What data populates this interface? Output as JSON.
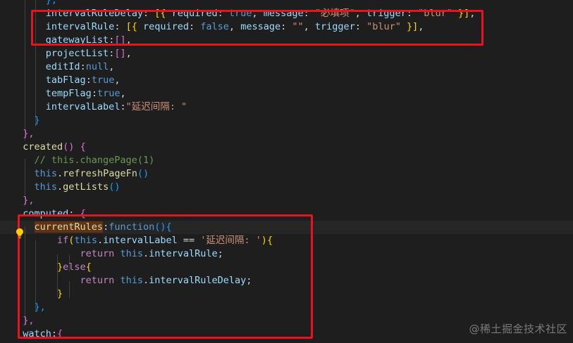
{
  "colors": {
    "background": "#1e1e1e",
    "plain": "#d4d4d4",
    "property": "#9cdcfe",
    "string": "#ce9178",
    "keyword": "#569cd6",
    "function": "#dcdcaa",
    "comment": "#6a9955",
    "control": "#c586c0",
    "bracket_gold": "#ffd700",
    "bracket_blue": "#179fff",
    "bracket_pink": "#da70d6",
    "highlight_box": "#e5141e"
  },
  "code": {
    "lines": [
      [
        {
          "t": "      ",
          "c": "plain"
        },
        {
          "t": "},",
          "c": "bracket_blue"
        }
      ],
      [
        {
          "t": "      ",
          "c": "plain"
        },
        {
          "t": "intervalRuleDelay",
          "c": "property"
        },
        {
          "t": ": ",
          "c": "plain"
        },
        {
          "t": "[{",
          "c": "bracket_gold"
        },
        {
          "t": " required",
          "c": "property"
        },
        {
          "t": ": ",
          "c": "plain"
        },
        {
          "t": "true",
          "c": "keyword"
        },
        {
          "t": ", ",
          "c": "plain"
        },
        {
          "t": "message",
          "c": "property"
        },
        {
          "t": ": ",
          "c": "plain"
        },
        {
          "t": "\"必填项\"",
          "c": "string"
        },
        {
          "t": ", ",
          "c": "plain"
        },
        {
          "t": "trigger",
          "c": "property"
        },
        {
          "t": ": ",
          "c": "plain"
        },
        {
          "t": "\"blur\"",
          "c": "string"
        },
        {
          "t": " }]",
          "c": "bracket_gold"
        },
        {
          "t": ",",
          "c": "plain"
        }
      ],
      [
        {
          "t": "      ",
          "c": "plain"
        },
        {
          "t": "intervalRule",
          "c": "property"
        },
        {
          "t": ": ",
          "c": "plain"
        },
        {
          "t": "[{",
          "c": "bracket_gold"
        },
        {
          "t": " required",
          "c": "property"
        },
        {
          "t": ": ",
          "c": "plain"
        },
        {
          "t": "false",
          "c": "keyword"
        },
        {
          "t": ", ",
          "c": "plain"
        },
        {
          "t": "message",
          "c": "property"
        },
        {
          "t": ": ",
          "c": "plain"
        },
        {
          "t": "\"\"",
          "c": "string"
        },
        {
          "t": ", ",
          "c": "plain"
        },
        {
          "t": "trigger",
          "c": "property"
        },
        {
          "t": ": ",
          "c": "plain"
        },
        {
          "t": "\"blur\"",
          "c": "string"
        },
        {
          "t": " }]",
          "c": "bracket_gold"
        },
        {
          "t": ",",
          "c": "plain"
        }
      ],
      [
        {
          "t": "      ",
          "c": "plain"
        },
        {
          "t": "gatewayList",
          "c": "property"
        },
        {
          "t": ":",
          "c": "plain"
        },
        {
          "t": "[]",
          "c": "bracket_pink"
        },
        {
          "t": ",",
          "c": "plain"
        }
      ],
      [
        {
          "t": "      ",
          "c": "plain"
        },
        {
          "t": "projectList",
          "c": "property"
        },
        {
          "t": ":",
          "c": "plain"
        },
        {
          "t": "[]",
          "c": "bracket_pink"
        },
        {
          "t": ",",
          "c": "plain"
        }
      ],
      [
        {
          "t": "      ",
          "c": "plain"
        },
        {
          "t": "editId",
          "c": "property"
        },
        {
          "t": ":",
          "c": "plain"
        },
        {
          "t": "null",
          "c": "keyword"
        },
        {
          "t": ",",
          "c": "plain"
        }
      ],
      [
        {
          "t": "      ",
          "c": "plain"
        },
        {
          "t": "tabFlag",
          "c": "property"
        },
        {
          "t": ":",
          "c": "plain"
        },
        {
          "t": "true",
          "c": "keyword"
        },
        {
          "t": ",",
          "c": "plain"
        }
      ],
      [
        {
          "t": "      ",
          "c": "plain"
        },
        {
          "t": "tempFlag",
          "c": "property"
        },
        {
          "t": ":",
          "c": "plain"
        },
        {
          "t": "true",
          "c": "keyword"
        },
        {
          "t": ",",
          "c": "plain"
        }
      ],
      [
        {
          "t": "      ",
          "c": "plain"
        },
        {
          "t": "intervalLabel",
          "c": "property"
        },
        {
          "t": ":",
          "c": "plain"
        },
        {
          "t": "\"延迟间隔: \"",
          "c": "string"
        }
      ],
      [
        {
          "t": "    ",
          "c": "plain"
        },
        {
          "t": "}",
          "c": "bracket_blue"
        }
      ],
      [
        {
          "t": "  ",
          "c": "plain"
        },
        {
          "t": "},",
          "c": "bracket_pink"
        }
      ],
      [
        {
          "t": "  ",
          "c": "plain"
        },
        {
          "t": "created",
          "c": "function"
        },
        {
          "t": "()",
          "c": "bracket_pink"
        },
        {
          "t": " ",
          "c": "plain"
        },
        {
          "t": "{",
          "c": "bracket_pink"
        }
      ],
      [
        {
          "t": "    ",
          "c": "plain"
        },
        {
          "t": "// this.changePage(1)",
          "c": "comment"
        }
      ],
      [
        {
          "t": "    ",
          "c": "plain"
        },
        {
          "t": "this",
          "c": "keyword"
        },
        {
          "t": ".",
          "c": "plain"
        },
        {
          "t": "refreshPageFn",
          "c": "function"
        },
        {
          "t": "()",
          "c": "bracket_blue"
        }
      ],
      [
        {
          "t": "    ",
          "c": "plain"
        },
        {
          "t": "this",
          "c": "keyword"
        },
        {
          "t": ".",
          "c": "plain"
        },
        {
          "t": "getLists",
          "c": "function"
        },
        {
          "t": "()",
          "c": "bracket_blue"
        }
      ],
      [
        {
          "t": "  ",
          "c": "plain"
        },
        {
          "t": "},",
          "c": "bracket_pink"
        }
      ],
      [
        {
          "t": "  ",
          "c": "plain"
        },
        {
          "t": "computed",
          "c": "property"
        },
        {
          "t": ": ",
          "c": "plain"
        },
        {
          "t": "{",
          "c": "bracket_pink"
        }
      ],
      [
        {
          "t": "    ",
          "c": "plain"
        },
        {
          "t": "currentRules",
          "c": "function",
          "sel": true
        },
        {
          "t": ":",
          "c": "plain"
        },
        {
          "t": "function",
          "c": "keyword"
        },
        {
          "t": "()",
          "c": "bracket_blue"
        },
        {
          "t": "{",
          "c": "bracket_blue"
        }
      ],
      [
        {
          "t": "        ",
          "c": "plain"
        },
        {
          "t": "if",
          "c": "control"
        },
        {
          "t": "(",
          "c": "bracket_gold"
        },
        {
          "t": "this",
          "c": "keyword"
        },
        {
          "t": ".",
          "c": "plain"
        },
        {
          "t": "intervalLabel",
          "c": "property"
        },
        {
          "t": " == ",
          "c": "plain"
        },
        {
          "t": "'延迟间隔: '",
          "c": "string"
        },
        {
          "t": ")",
          "c": "bracket_gold"
        },
        {
          "t": "{",
          "c": "bracket_gold"
        }
      ],
      [
        {
          "t": "            ",
          "c": "plain"
        },
        {
          "t": "return",
          "c": "control"
        },
        {
          "t": " ",
          "c": "plain"
        },
        {
          "t": "this",
          "c": "keyword"
        },
        {
          "t": ".",
          "c": "plain"
        },
        {
          "t": "intervalRule",
          "c": "property"
        },
        {
          "t": ";",
          "c": "plain"
        }
      ],
      [
        {
          "t": "        ",
          "c": "plain"
        },
        {
          "t": "}",
          "c": "bracket_gold"
        },
        {
          "t": "else",
          "c": "control"
        },
        {
          "t": "{",
          "c": "bracket_gold"
        }
      ],
      [
        {
          "t": "            ",
          "c": "plain"
        },
        {
          "t": "return",
          "c": "control"
        },
        {
          "t": " ",
          "c": "plain"
        },
        {
          "t": "this",
          "c": "keyword"
        },
        {
          "t": ".",
          "c": "plain"
        },
        {
          "t": "intervalRuleDelay",
          "c": "property"
        },
        {
          "t": ";",
          "c": "plain"
        }
      ],
      [
        {
          "t": "        ",
          "c": "plain"
        },
        {
          "t": "}",
          "c": "bracket_gold"
        }
      ],
      [
        {
          "t": "    ",
          "c": "plain"
        },
        {
          "t": "},",
          "c": "bracket_blue"
        }
      ],
      [
        {
          "t": "  ",
          "c": "plain"
        },
        {
          "t": "},",
          "c": "bracket_pink"
        }
      ],
      [
        {
          "t": "  ",
          "c": "plain"
        },
        {
          "t": "watch",
          "c": "property"
        },
        {
          "t": ":",
          "c": "plain"
        },
        {
          "t": "{",
          "c": "bracket_pink"
        }
      ]
    ]
  },
  "icons": {
    "lightbulb": "lightbulb-icon"
  },
  "watermark": {
    "text": "@稀土掘金技术社区"
  }
}
